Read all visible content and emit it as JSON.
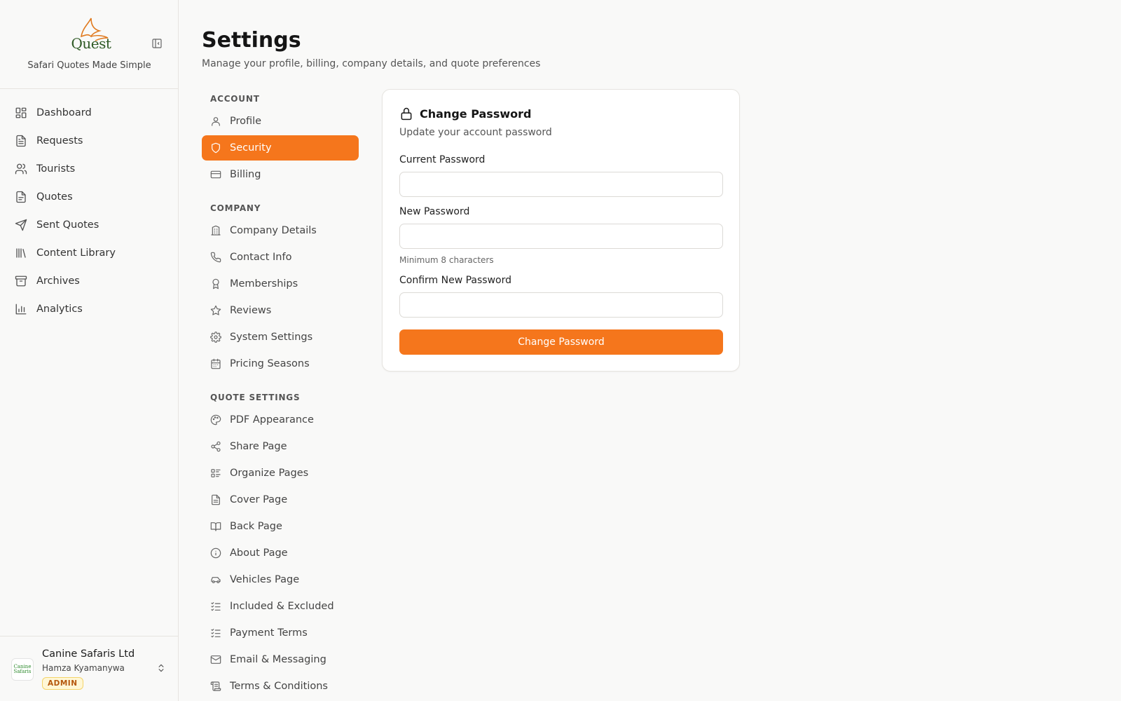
{
  "brand": {
    "logo_word": "Quest",
    "tagline": "Safari Quotes Made Simple"
  },
  "main_nav": [
    {
      "label": "Dashboard",
      "icon": "dashboard-icon"
    },
    {
      "label": "Requests",
      "icon": "file-text-icon"
    },
    {
      "label": "Tourists",
      "icon": "users-icon"
    },
    {
      "label": "Quotes",
      "icon": "file-icon"
    },
    {
      "label": "Sent Quotes",
      "icon": "send-icon"
    },
    {
      "label": "Content Library",
      "icon": "library-icon"
    },
    {
      "label": "Archives",
      "icon": "archive-icon"
    },
    {
      "label": "Analytics",
      "icon": "bar-chart-icon"
    }
  ],
  "account": {
    "company_name": "Canine Safaris Ltd",
    "user_name": "Hamza Kyamanywa",
    "role": "ADMIN",
    "company_logo_text": "Canine Safaris"
  },
  "header": {
    "title": "Settings",
    "subtitle": "Manage your profile, billing, company details, and quote preferences"
  },
  "settings_nav": {
    "account_heading": "ACCOUNT",
    "company_heading": "COMPANY",
    "quote_heading": "QUOTE SETTINGS",
    "account": [
      {
        "label": "Profile",
        "icon": "user-icon"
      },
      {
        "label": "Security",
        "icon": "shield-icon",
        "active": true
      },
      {
        "label": "Billing",
        "icon": "credit-card-icon"
      }
    ],
    "company": [
      {
        "label": "Company Details",
        "icon": "building-icon"
      },
      {
        "label": "Contact Info",
        "icon": "phone-icon"
      },
      {
        "label": "Memberships",
        "icon": "award-icon"
      },
      {
        "label": "Reviews",
        "icon": "star-icon"
      },
      {
        "label": "System Settings",
        "icon": "gear-icon"
      },
      {
        "label": "Pricing Seasons",
        "icon": "calendar-icon"
      }
    ],
    "quote": [
      {
        "label": "PDF Appearance",
        "icon": "palette-icon"
      },
      {
        "label": "Share Page",
        "icon": "share-icon"
      },
      {
        "label": "Organize Pages",
        "icon": "list-icon"
      },
      {
        "label": "Cover Page",
        "icon": "file-text-icon"
      },
      {
        "label": "Back Page",
        "icon": "book-open-icon"
      },
      {
        "label": "About Page",
        "icon": "info-icon"
      },
      {
        "label": "Vehicles Page",
        "icon": "car-icon"
      },
      {
        "label": "Included & Excluded",
        "icon": "list-checks-icon"
      },
      {
        "label": "Payment Terms",
        "icon": "list-checks-icon"
      },
      {
        "label": "Email & Messaging",
        "icon": "mail-icon"
      },
      {
        "label": "Terms & Conditions",
        "icon": "scroll-icon"
      }
    ]
  },
  "password_card": {
    "title": "Change Password",
    "description": "Update your account password",
    "current_label": "Current Password",
    "current_value": "",
    "new_label": "New Password",
    "new_value": "",
    "new_hint": "Minimum 8 characters",
    "confirm_label": "Confirm New Password",
    "confirm_value": "",
    "submit_label": "Change Password"
  },
  "colors": {
    "accent": "#f5761c",
    "badge_bg": "#fff7d6",
    "badge_text": "#b5570c"
  }
}
